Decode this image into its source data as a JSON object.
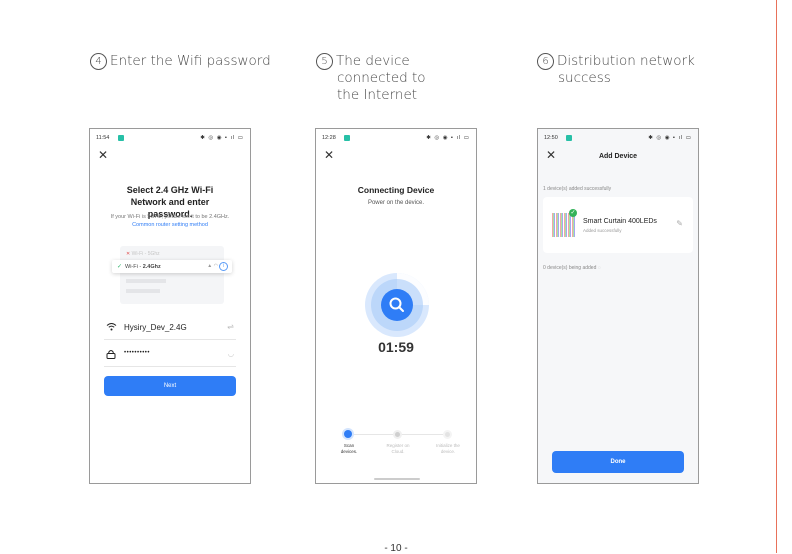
{
  "steps": [
    {
      "num": "4",
      "lines": [
        "Enter the Wifi password"
      ]
    },
    {
      "num": "5",
      "lines": [
        "The device",
        "connected to",
        "the Internet"
      ]
    },
    {
      "num": "6",
      "lines": [
        "Distribution network",
        "success"
      ]
    }
  ],
  "phone1": {
    "time": "11:54",
    "status_icons": "✱ ◎ ◉ ▪ ıl ▭",
    "title": "Select 2.4 GHz Wi-Fi Network and enter password.",
    "note": "If your Wi-Fi is 5GHz, please set it to be 2.4GHz.",
    "link": "Common router setting method",
    "wifi_5g_prefix": "Wi-Fi - ",
    "wifi_5g_band": "5Ghz",
    "wifi_24_prefix": "Wi-Fi - ",
    "wifi_24_band": "2.4Ghz",
    "network_name": "Hysiry_Dev_2.4G",
    "password": "••••••••••",
    "next_label": "Next"
  },
  "phone2": {
    "time": "12:28",
    "status_icons": "✱ ◎ ◉ ▪ ıl ▭",
    "title": "Connecting Device",
    "subtitle": "Power on the device.",
    "timer": "01:59",
    "steps": [
      {
        "label1": "Scan",
        "label2": "devices."
      },
      {
        "label1": "Register on",
        "label2": "Cloud."
      },
      {
        "label1": "Initialize the",
        "label2": "device."
      }
    ]
  },
  "phone3": {
    "time": "12:50",
    "status_icons": "✱ ◎ ◉ ▪ ıl ▭",
    "title": "Add Device",
    "added_text": "1 device(s) added successfully",
    "device_name": "Smart Curtain 400LEDs",
    "device_status": "Added successfully",
    "adding_text": "0 device(s) being added",
    "done_label": "Done"
  },
  "page_number": "- 10 -"
}
